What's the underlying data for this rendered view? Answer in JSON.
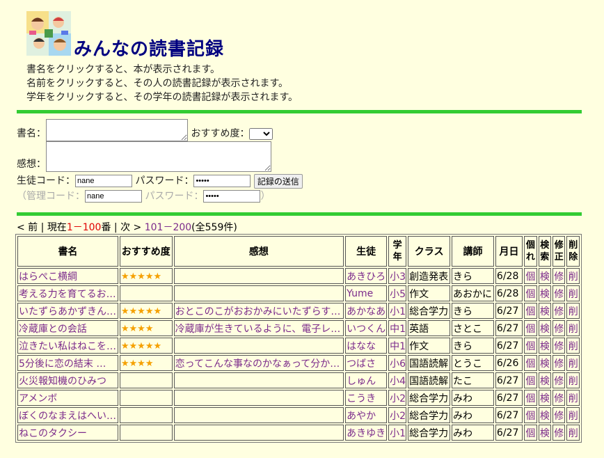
{
  "header": {
    "title": "みんなの読書記録",
    "intro": [
      "書名をクリックすると、本が表示されます。",
      "名前をクリックすると、その人の読書記録が表示されます。",
      "学年をクリックすると、その学年の読書記録が表示されます。"
    ]
  },
  "form": {
    "book_label": "書名：",
    "recommend_label": "おすすめ度：",
    "impression_label": "感想：",
    "student_code_label": "生徒コード：",
    "student_code_value": "nane",
    "password_label": "パスワード：",
    "password_value": "•••••",
    "submit_label": "記録の送信",
    "admin_open": "（管理コード：",
    "admin_code_value": "nane",
    "admin_password_label": "パスワード：",
    "admin_password_value": "•••••",
    "admin_close": "）"
  },
  "pager": {
    "prev": "< 前",
    "sep1": " | ",
    "current_prefix": "現在",
    "current_range": "1－100",
    "current_suffix": "番",
    "sep2": " | ",
    "next": "次 >",
    "next_range": "101－200",
    "total": "(全559件)"
  },
  "table": {
    "headers": {
      "title": "書名",
      "recommend": "おすすめ度",
      "impression": "感想",
      "student": "生徒",
      "grade": "学年",
      "class": "クラス",
      "teacher": "講師",
      "date": "月日",
      "individual": "個れ",
      "search": "検索",
      "edit": "修正",
      "delete": "削除"
    },
    "rows": [
      {
        "title": "はらぺこ横綱",
        "stars": "★★★★★",
        "impression": "",
        "student": "あきひろ",
        "grade": "小3",
        "class": "創造発表",
        "teacher": "きら",
        "date": "6/28",
        "k1": "個",
        "k2": "検",
        "k3": "修",
        "k4": "削"
      },
      {
        "title": "考える力を育てるお…",
        "stars": "",
        "impression": "",
        "student": "Yume",
        "grade": "小5",
        "class": "作文",
        "teacher": "あおかに",
        "date": "6/28",
        "k1": "個",
        "k2": "検",
        "k3": "修",
        "k4": "削"
      },
      {
        "title": "いたずらあかずきん…",
        "stars": "★★★★★",
        "impression": "おとこのこがおおかみにいたずらす…",
        "student": "あかなあ",
        "grade": "小1",
        "class": "総合学力",
        "teacher": "きら",
        "date": "6/27",
        "k1": "個",
        "k2": "検",
        "k3": "修",
        "k4": "削"
      },
      {
        "title": "冷蔵庫との会話",
        "stars": "★★★★",
        "impression": "冷蔵庫が生きているように、電子レ…",
        "student": "いつくん",
        "grade": "中1",
        "class": "英語",
        "teacher": "さとこ",
        "date": "6/27",
        "k1": "個",
        "k2": "検",
        "k3": "修",
        "k4": "削"
      },
      {
        "title": "泣きたい私はねこを…",
        "stars": "★★★★★",
        "impression": "",
        "student": "はなな",
        "grade": "中1",
        "class": "作文",
        "teacher": "きら",
        "date": "6/27",
        "k1": "個",
        "k2": "検",
        "k3": "修",
        "k4": "削"
      },
      {
        "title": "5分後に恋の結末 …",
        "stars": "★★★★",
        "impression": "恋ってこんな事なのかなぁって分か…",
        "student": "つばさ",
        "grade": "小6",
        "class": "国語読解",
        "teacher": "とうこ",
        "date": "6/26",
        "k1": "個",
        "k2": "検",
        "k3": "修",
        "k4": "削"
      },
      {
        "title": "火災報知機のひみつ",
        "stars": "",
        "impression": "",
        "student": "しゅん",
        "grade": "小4",
        "class": "国語読解",
        "teacher": "たこ",
        "date": "6/27",
        "k1": "個",
        "k2": "検",
        "k3": "修",
        "k4": "削"
      },
      {
        "title": "アメンボ",
        "stars": "",
        "impression": "",
        "student": "こうき",
        "grade": "小2",
        "class": "総合学力",
        "teacher": "みわ",
        "date": "6/27",
        "k1": "個",
        "k2": "検",
        "k3": "修",
        "k4": "削"
      },
      {
        "title": "ぼくのなまえはへい…",
        "stars": "",
        "impression": "",
        "student": "あやか",
        "grade": "小2",
        "class": "総合学力",
        "teacher": "みわ",
        "date": "6/27",
        "k1": "個",
        "k2": "検",
        "k3": "修",
        "k4": "削"
      },
      {
        "title": "ねこのタクシー",
        "stars": "",
        "impression": "",
        "student": "あきゆき",
        "grade": "小1",
        "class": "総合学力",
        "teacher": "みわ",
        "date": "6/27",
        "k1": "個",
        "k2": "検",
        "k3": "修",
        "k4": "削"
      }
    ]
  }
}
